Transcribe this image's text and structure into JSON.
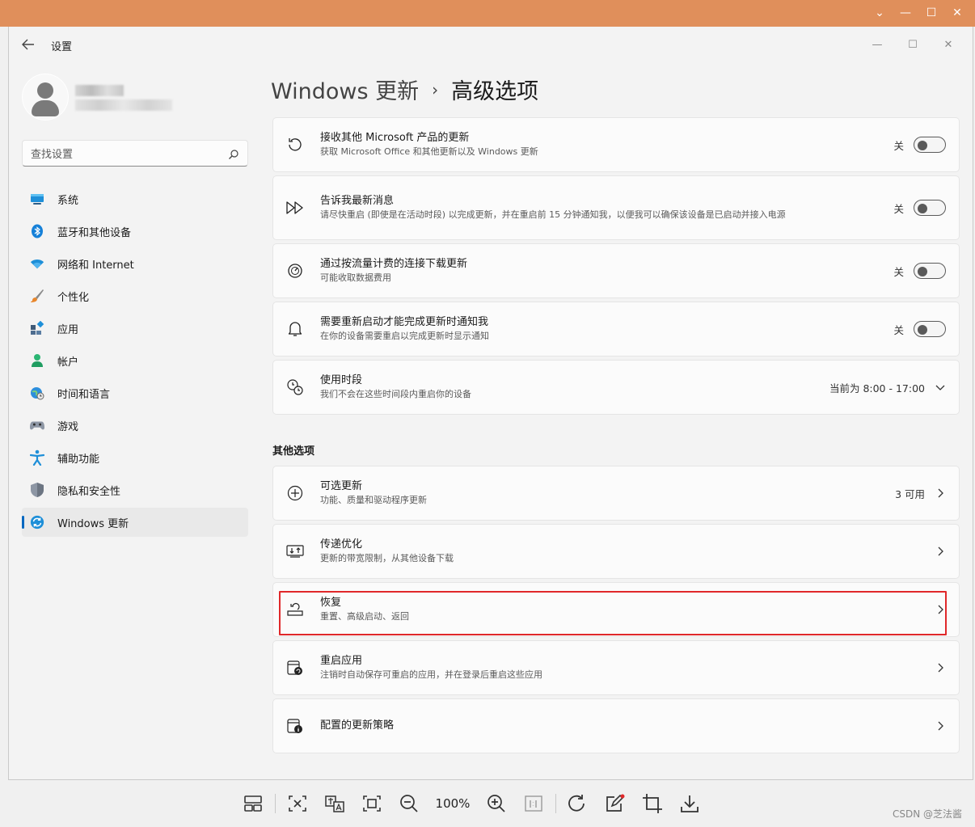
{
  "app": {
    "title": "设置"
  },
  "search": {
    "placeholder": "查找设置"
  },
  "nav": {
    "items": [
      {
        "label": "系统",
        "icon": "display-icon"
      },
      {
        "label": "蓝牙和其他设备",
        "icon": "bluetooth-icon"
      },
      {
        "label": "网络和 Internet",
        "icon": "wifi-icon"
      },
      {
        "label": "个性化",
        "icon": "brush-icon"
      },
      {
        "label": "应用",
        "icon": "apps-icon"
      },
      {
        "label": "帐户",
        "icon": "person-icon"
      },
      {
        "label": "时间和语言",
        "icon": "globe-clock-icon"
      },
      {
        "label": "游戏",
        "icon": "gamepad-icon"
      },
      {
        "label": "辅助功能",
        "icon": "accessibility-icon"
      },
      {
        "label": "隐私和安全性",
        "icon": "shield-icon"
      },
      {
        "label": "Windows 更新",
        "icon": "windows-update-icon",
        "active": true
      }
    ]
  },
  "breadcrumb": {
    "parent": "Windows 更新",
    "separator": "›",
    "current": "高级选项"
  },
  "settings": {
    "receive_other": {
      "title": "接收其他 Microsoft 产品的更新",
      "subtitle": "获取 Microsoft Office 和其他更新以及 Windows 更新",
      "state": "关"
    },
    "notify_me": {
      "title": "告诉我最新消息",
      "subtitle": "请尽快重启 (即使是在活动时段) 以完成更新，并在重启前 15 分钟通知我，以便我可以确保该设备是已启动并接入电源",
      "state": "关"
    },
    "metered": {
      "title": "通过按流量计费的连接下载更新",
      "subtitle": "可能收取数据费用",
      "state": "关"
    },
    "restart_notify": {
      "title": "需要重新启动才能完成更新时通知我",
      "subtitle": "在你的设备需要重启以完成更新时显示通知",
      "state": "关"
    },
    "active_hours": {
      "title": "使用时段",
      "subtitle": "我们不会在这些时间段内重启你的设备",
      "value": "当前为 8:00 - 17:00"
    }
  },
  "other": {
    "section_title": "其他选项",
    "optional": {
      "title": "可选更新",
      "subtitle": "功能、质量和驱动程序更新",
      "value": "3 可用"
    },
    "delivery": {
      "title": "传递优化",
      "subtitle": "更新的带宽限制，从其他设备下载"
    },
    "recovery": {
      "title": "恢复",
      "subtitle": "重置、高级启动、返回"
    },
    "restart_apps": {
      "title": "重启应用",
      "subtitle": "注销时自动保存可重启的应用，并在登录后重启这些应用"
    },
    "policies": {
      "title": "配置的更新策略"
    }
  },
  "toolbar": {
    "zoom": "100%"
  },
  "watermark": "CSDN @芝法酱",
  "colors": {
    "accent": "#0067c0",
    "highlight": "#e0282a",
    "outer_titlebar": "#e08f5b"
  }
}
